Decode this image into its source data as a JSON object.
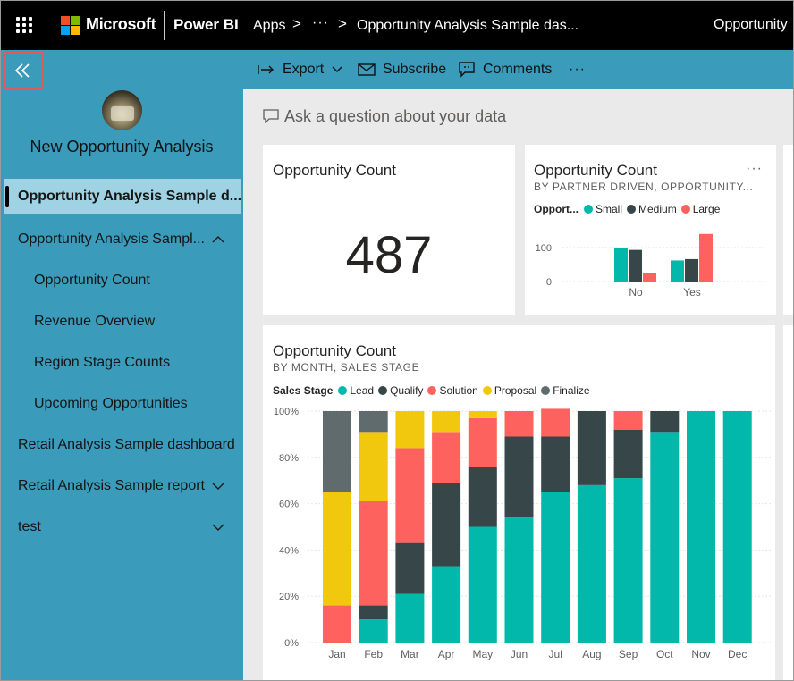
{
  "topbar": {
    "brand": "Microsoft",
    "product": "Power BI",
    "crumb_apps": "Apps",
    "crumb_more": "···",
    "crumb_report": "Opportunity Analysis Sample das...",
    "right_title": "Opportunity"
  },
  "toolbar": {
    "export_label": "Export",
    "subscribe_label": "Subscribe",
    "comments_label": "Comments",
    "more_label": "···"
  },
  "nav": {
    "app_title": "New Opportunity Analysis",
    "items": [
      {
        "label": "Opportunity Analysis Sample d...",
        "selected": true,
        "chevron": ""
      },
      {
        "label": "Opportunity Analysis Sampl...",
        "selected": false,
        "chevron": "up"
      },
      {
        "label": "Opportunity Count",
        "selected": false,
        "chevron": ""
      },
      {
        "label": "Revenue Overview",
        "selected": false,
        "chevron": ""
      },
      {
        "label": "Region Stage Counts",
        "selected": false,
        "chevron": ""
      },
      {
        "label": "Upcoming Opportunities",
        "selected": false,
        "chevron": ""
      },
      {
        "label": "Retail Analysis Sample dashboard",
        "selected": false,
        "chevron": ""
      },
      {
        "label": "Retail Analysis Sample report",
        "selected": false,
        "chevron": "down"
      },
      {
        "label": "test",
        "selected": false,
        "chevron": "down"
      }
    ]
  },
  "qna": {
    "placeholder": "Ask a question about your data"
  },
  "tiles": {
    "card": {
      "title": "Opportunity Count",
      "value": "487"
    },
    "partner": {
      "title": "Opportunity Count",
      "subtitle": "BY PARTNER DRIVEN, OPPORTUNITY...",
      "legend_title": "Opport...",
      "more": "···"
    },
    "monthly": {
      "title": "Opportunity Count",
      "subtitle": "BY MONTH, SALES STAGE",
      "legend_title": "Sales Stage"
    }
  },
  "colors": {
    "nav_bg": "#3a9bba",
    "nav_selected": "#9fd3e3",
    "teal": "#01b8aa",
    "dark": "#374649",
    "red": "#fd625e",
    "yellow": "#f2c80f",
    "gray": "#5f6b6d"
  },
  "chart_data": [
    {
      "type": "bar",
      "title": "Opportunity Count",
      "subtitle": "BY PARTNER DRIVEN, OPPORTUNITY...",
      "categories": [
        "No",
        "Yes"
      ],
      "series": [
        {
          "name": "Small",
          "color": "#01b8aa",
          "values": [
            100,
            62
          ]
        },
        {
          "name": "Medium",
          "color": "#374649",
          "values": [
            93,
            66
          ]
        },
        {
          "name": "Large",
          "color": "#fd625e",
          "values": [
            24,
            140
          ]
        }
      ],
      "y_ticks": [
        0,
        100
      ],
      "ylim": [
        0,
        150
      ],
      "legend_position": "top"
    },
    {
      "type": "bar",
      "stacked": "100%",
      "title": "Opportunity Count",
      "subtitle": "BY MONTH, SALES STAGE",
      "categories": [
        "Jan",
        "Feb",
        "Mar",
        "Apr",
        "May",
        "Jun",
        "Jul",
        "Aug",
        "Sep",
        "Oct",
        "Nov",
        "Dec"
      ],
      "series": [
        {
          "name": "Lead",
          "color": "#01b8aa",
          "values": [
            0,
            10,
            21,
            33,
            50,
            54,
            65,
            68,
            71,
            91,
            100,
            100
          ]
        },
        {
          "name": "Qualify",
          "color": "#374649",
          "values": [
            0,
            6,
            22,
            36,
            26,
            35,
            24,
            32,
            21,
            9,
            0,
            0
          ]
        },
        {
          "name": "Solution",
          "color": "#fd625e",
          "values": [
            16,
            45,
            41,
            22,
            21,
            11,
            12,
            0,
            8,
            0,
            0,
            0
          ]
        },
        {
          "name": "Proposal",
          "color": "#f2c80f",
          "values": [
            49,
            30,
            16,
            9,
            3,
            0,
            0,
            0,
            0,
            0,
            0,
            0
          ]
        },
        {
          "name": "Finalize",
          "color": "#5f6b6d",
          "values": [
            35,
            9,
            0,
            0,
            0,
            0,
            0,
            0,
            0,
            0,
            0,
            0
          ]
        }
      ],
      "y_ticks": [
        "0%",
        "20%",
        "40%",
        "60%",
        "80%",
        "100%"
      ],
      "ylim": [
        0,
        100
      ],
      "legend_position": "top-left"
    }
  ]
}
